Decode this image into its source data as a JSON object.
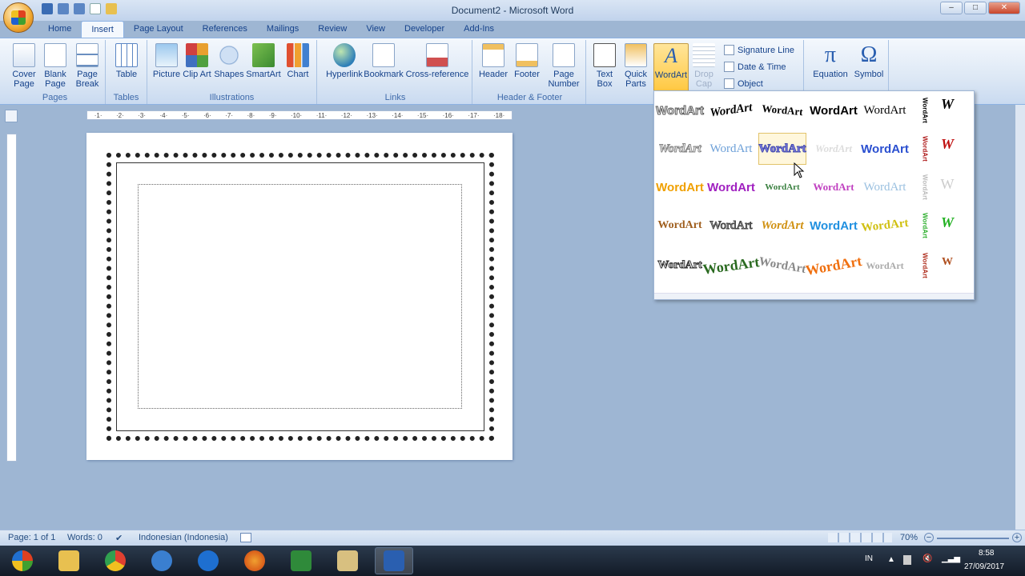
{
  "window": {
    "title": "Document2 - Microsoft Word"
  },
  "tabs": [
    "Home",
    "Insert",
    "Page Layout",
    "References",
    "Mailings",
    "Review",
    "View",
    "Developer",
    "Add-Ins"
  ],
  "ribbon": {
    "groups": {
      "pages": "Pages",
      "tables": "Tables",
      "illustrations": "Illustrations",
      "links": "Links",
      "header_footer": "Header & Footer"
    },
    "buttons": {
      "cover_page": "Cover Page",
      "blank_page": "Blank Page",
      "page_break": "Page Break",
      "table": "Table",
      "picture": "Picture",
      "clip_art": "Clip Art",
      "shapes": "Shapes",
      "smartart": "SmartArt",
      "chart": "Chart",
      "hyperlink": "Hyperlink",
      "bookmark": "Bookmark",
      "cross_reference": "Cross-reference",
      "header": "Header",
      "footer": "Footer",
      "page_number": "Page Number",
      "text_box": "Text Box",
      "quick_parts": "Quick Parts",
      "wordart": "WordArt",
      "drop_cap": "Drop Cap",
      "signature_line": "Signature Line",
      "date_time": "Date & Time",
      "object": "Object",
      "equation": "Equation",
      "symbol": "Symbol"
    }
  },
  "gallery": {
    "sample_text": "WordArt",
    "w_letter": "W"
  },
  "status": {
    "page": "Page: 1 of 1",
    "words": "Words: 0",
    "language": "Indonesian (Indonesia)",
    "zoom": "70%"
  },
  "taskbar": {
    "lang": "IN",
    "time": "8:58",
    "date": "27/09/2017"
  },
  "colors": {
    "accent": "#15428b",
    "ribbon_selected": "#ffc840"
  }
}
